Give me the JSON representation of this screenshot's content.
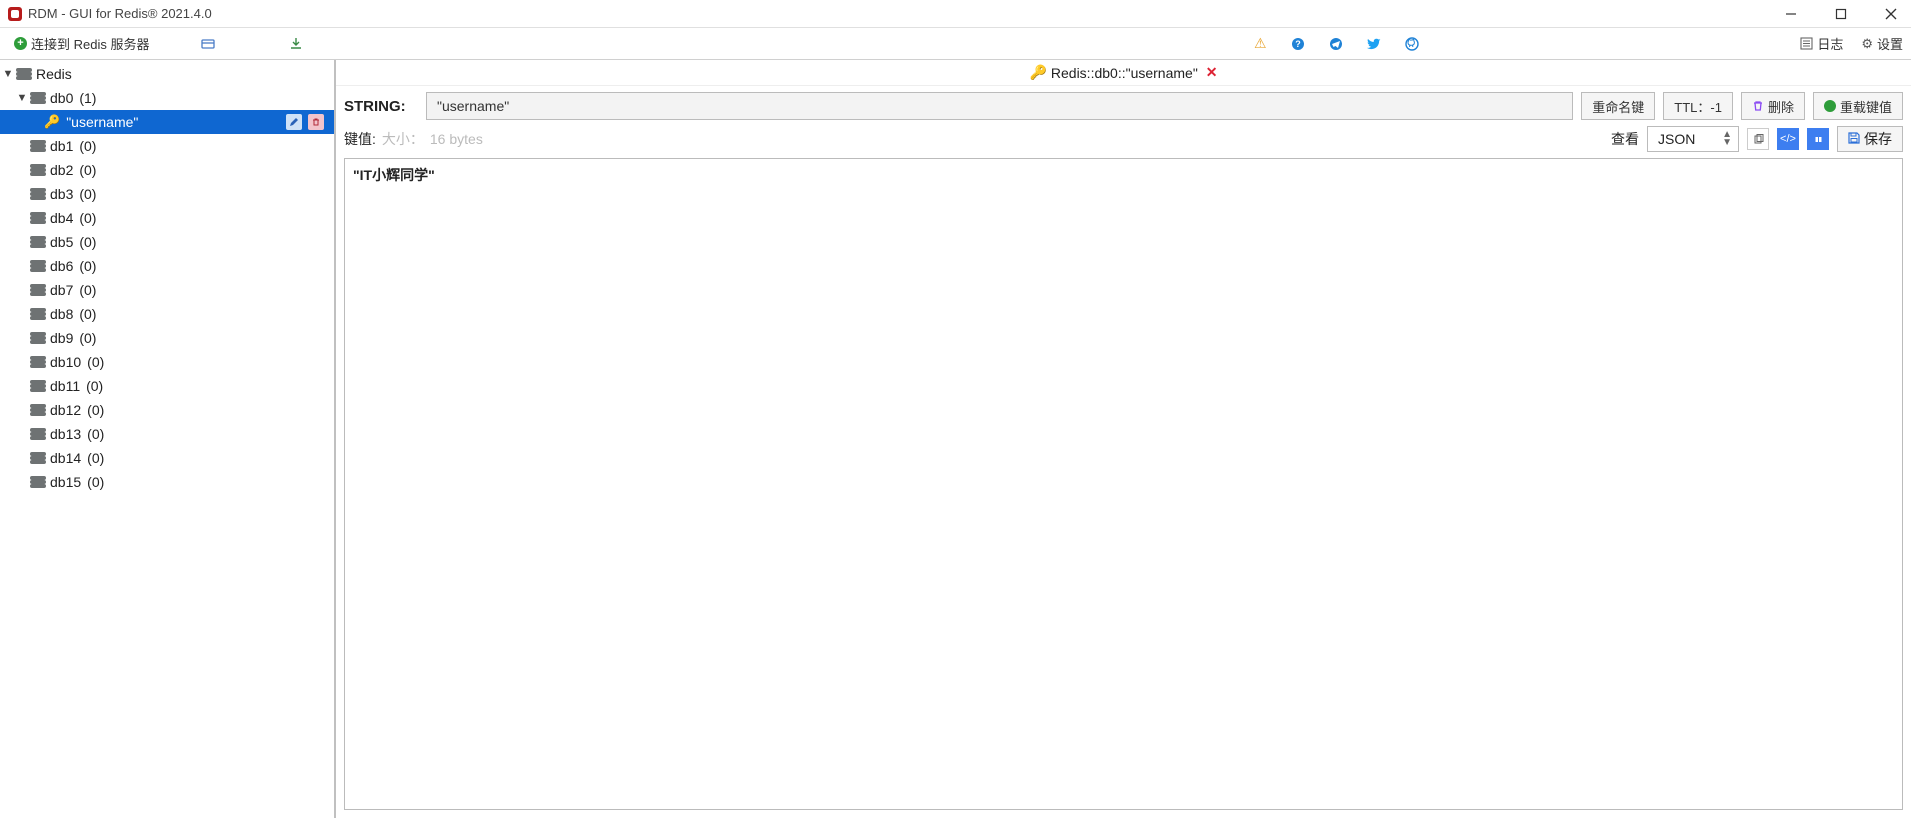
{
  "title": "RDM - GUI for Redis® 2021.4.0",
  "toolbar": {
    "connect_label": "连接到 Redis 服务器",
    "log_label": "日志",
    "settings_label": "设置"
  },
  "tree": {
    "connection": "Redis",
    "selected_key": "\"username\"",
    "dbs": [
      {
        "name": "db0",
        "count": "(1)",
        "expanded": true
      },
      {
        "name": "db1",
        "count": "(0)"
      },
      {
        "name": "db2",
        "count": "(0)"
      },
      {
        "name": "db3",
        "count": "(0)"
      },
      {
        "name": "db4",
        "count": "(0)"
      },
      {
        "name": "db5",
        "count": "(0)"
      },
      {
        "name": "db6",
        "count": "(0)"
      },
      {
        "name": "db7",
        "count": "(0)"
      },
      {
        "name": "db8",
        "count": "(0)"
      },
      {
        "name": "db9",
        "count": "(0)"
      },
      {
        "name": "db10",
        "count": "(0)"
      },
      {
        "name": "db11",
        "count": "(0)"
      },
      {
        "name": "db12",
        "count": "(0)"
      },
      {
        "name": "db13",
        "count": "(0)"
      },
      {
        "name": "db14",
        "count": "(0)"
      },
      {
        "name": "db15",
        "count": "(0)"
      }
    ]
  },
  "tab": {
    "title": "Redis::db0::\"username\"",
    "type_label": "STRING:",
    "key_name": "\"username\"",
    "rename_label": "重命名键",
    "ttl_label": "TTL：-1",
    "delete_label": "删除",
    "reload_label": "重载键值",
    "value_label": "键值:",
    "size_label": "大小：",
    "size_value": "16 bytes",
    "view_label": "查看",
    "format_selected": "JSON",
    "save_label": "保存",
    "value": "\"IT小辉同学\""
  }
}
